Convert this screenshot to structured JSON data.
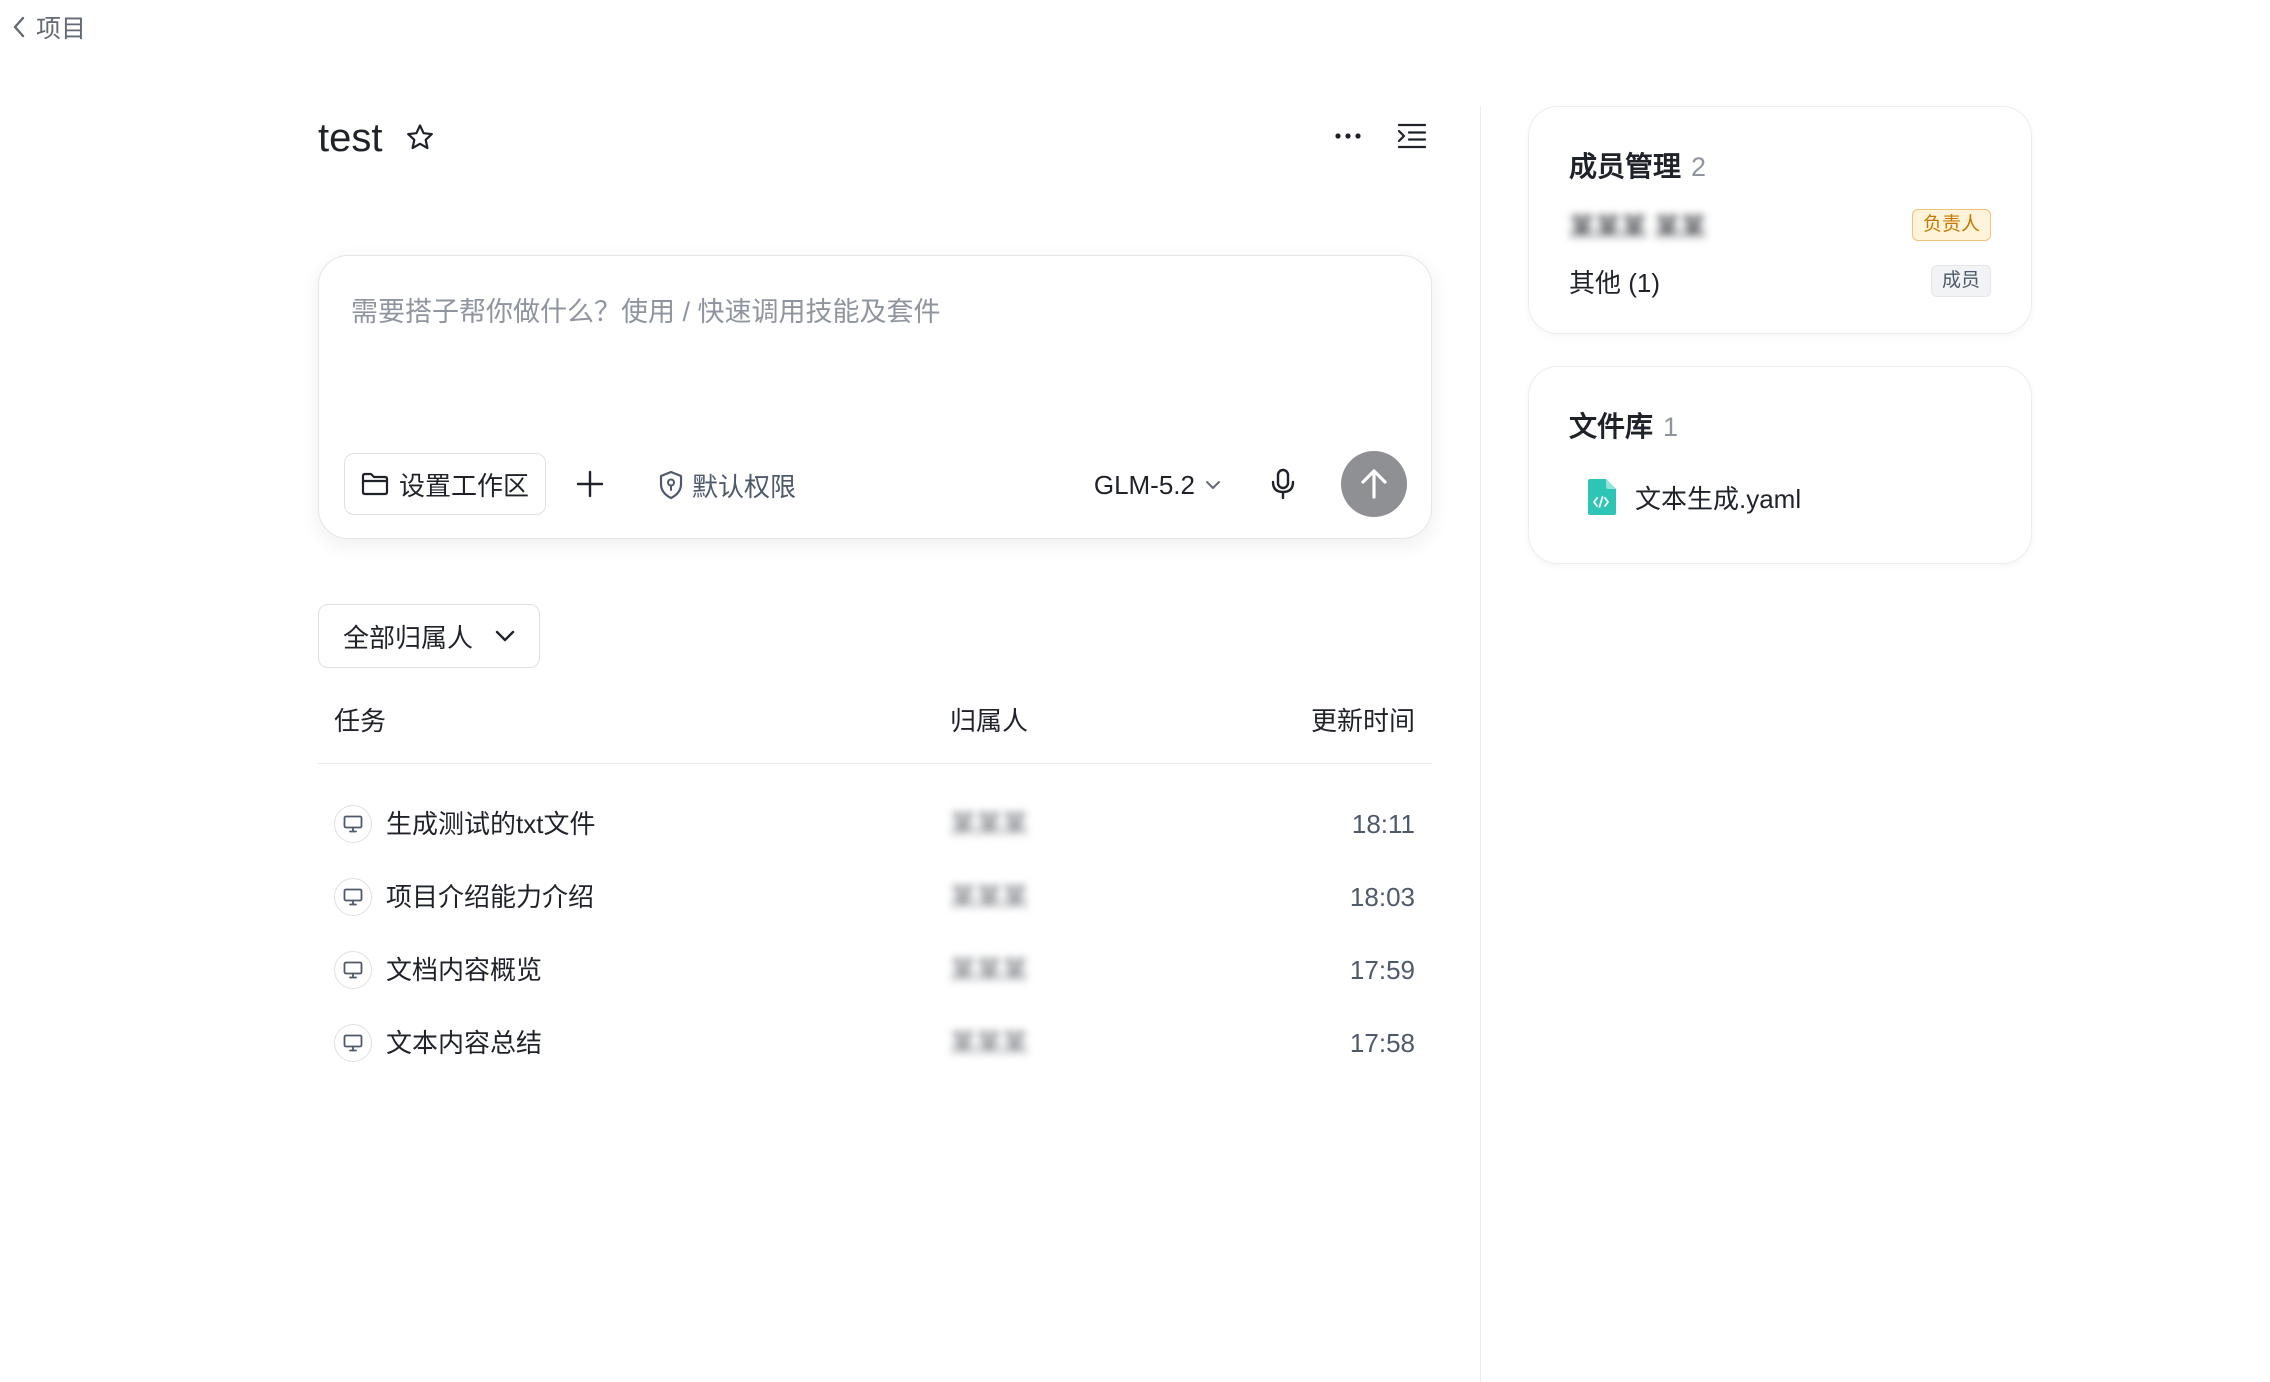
{
  "nav": {
    "back_label": "项目"
  },
  "project": {
    "title": "test"
  },
  "composer": {
    "placeholder": "需要搭子帮你做什么？使用 / 快速调用技能及套件",
    "workspace_label": "设置工作区",
    "permission_label": "默认权限",
    "model_label": "GLM-5.2"
  },
  "filter": {
    "label": "全部归属人"
  },
  "table": {
    "headers": {
      "task": "任务",
      "owner": "归属人",
      "time": "更新时间"
    },
    "rows": [
      {
        "task": "生成测试的txt文件",
        "owner": "某某某",
        "time": "18:11"
      },
      {
        "task": "项目介绍能力介绍",
        "owner": "某某某",
        "time": "18:03"
      },
      {
        "task": "文档内容概览",
        "owner": "某某某",
        "time": "17:59"
      },
      {
        "task": "文本内容总结",
        "owner": "某某某",
        "time": "17:58"
      }
    ]
  },
  "members_card": {
    "title": "成员管理",
    "count": "2",
    "owner_name": "某某某 某某",
    "owner_tag": "负责人",
    "others_label": "其他 (1)",
    "member_tag": "成员"
  },
  "files_card": {
    "title": "文件库",
    "count": "1",
    "file_name": "文本生成.yaml"
  },
  "colors": {
    "send_button": "#8f9093",
    "owner_tag_bg": "#fff3d9",
    "owner_tag_text": "#c47a00",
    "file_icon": "#2ec4b6"
  }
}
